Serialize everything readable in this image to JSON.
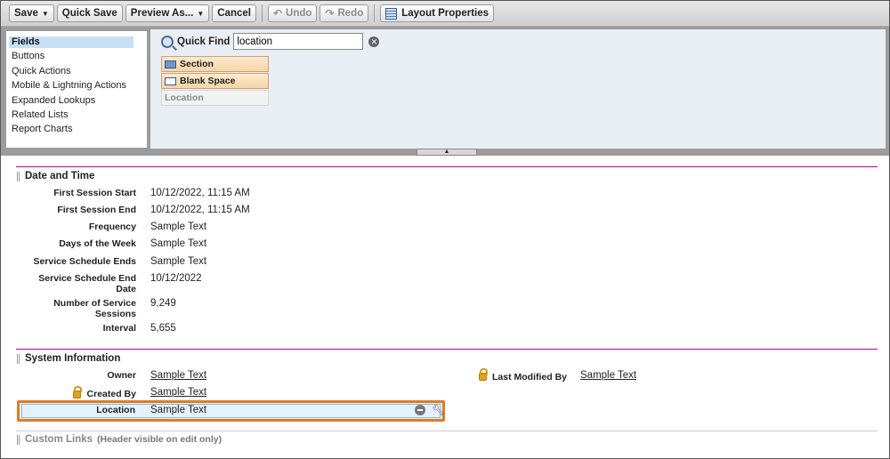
{
  "toolbar": {
    "save": "Save",
    "quick_save": "Quick Save",
    "preview_as": "Preview As...",
    "cancel": "Cancel",
    "undo": "Undo",
    "redo": "Redo",
    "layout_properties": "Layout Properties"
  },
  "palette": {
    "categories": [
      "Fields",
      "Buttons",
      "Quick Actions",
      "Mobile & Lightning Actions",
      "Expanded Lookups",
      "Related Lists",
      "Report Charts"
    ],
    "quick_find_label": "Quick Find",
    "quick_find_value": "location",
    "items": [
      "Section",
      "Blank Space",
      "Location"
    ]
  },
  "sections": {
    "date_time": {
      "title": "Date and Time",
      "fields": [
        {
          "label": "First Session Start",
          "value": "10/12/2022, 11:15 AM"
        },
        {
          "label": "First Session End",
          "value": "10/12/2022, 11:15 AM"
        },
        {
          "label": "Frequency",
          "value": "Sample Text"
        },
        {
          "label": "Days of the Week",
          "value": "Sample Text"
        },
        {
          "label": "Service Schedule Ends",
          "value": "Sample Text"
        },
        {
          "label": "Service Schedule End Date",
          "value": "10/12/2022"
        },
        {
          "label": "Number of Service Sessions",
          "value": "9,249"
        },
        {
          "label": "Interval",
          "value": "5,655"
        }
      ]
    },
    "system_info": {
      "title": "System Information",
      "owner_label": "Owner",
      "owner_value": "Sample Text",
      "created_by_label": "Created By",
      "created_by_value": "Sample Text",
      "last_modified_label": "Last Modified By",
      "last_modified_value": "Sample Text",
      "location_label": "Location",
      "location_value": "Sample Text"
    },
    "custom_links": {
      "title": "Custom Links",
      "subtitle": "(Header visible on edit only)"
    }
  }
}
